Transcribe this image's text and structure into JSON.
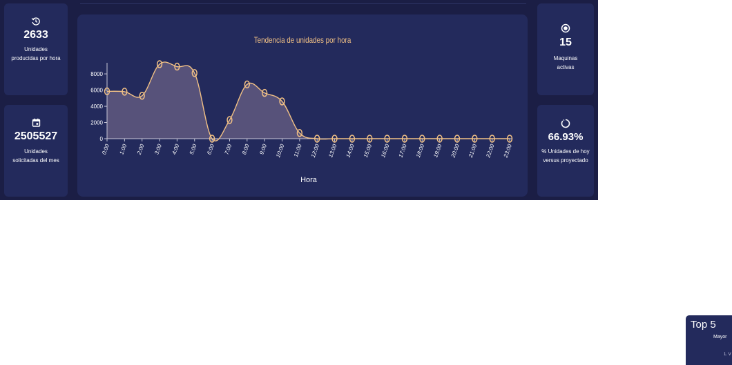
{
  "kpis": {
    "produced": {
      "value": "2633",
      "label": "Unidades producidas por hora",
      "icon": "clock-reset-icon"
    },
    "requested": {
      "value": "2505527",
      "label": "Unidades solicitadas del mes",
      "icon": "calendar-icon"
    },
    "machines": {
      "value": "15",
      "label": "Maquinas activas",
      "icon": "radio-dot-icon"
    },
    "percent": {
      "value": "66.93%",
      "label": "% Unidades de hoy versus proyectado",
      "icon": "circle-progress-icon"
    }
  },
  "top5": {
    "title": "Top 5",
    "subtitle": "Mayor",
    "first_item": "1. V"
  },
  "colors": {
    "background": "#1b1e45",
    "card": "#232a5c",
    "line": "#f2c185",
    "area": "#57527a"
  },
  "chart_data": {
    "type": "area",
    "title": "Tendencia de unidades por hora",
    "xlabel": "Hora",
    "ylabel": "",
    "categories": [
      "0:00",
      "1:00",
      "2:00",
      "3:00",
      "4:00",
      "5:00",
      "6:00",
      "7:00",
      "8:00",
      "9:00",
      "10:00",
      "11:00",
      "12:00",
      "13:00",
      "14:00",
      "15:00",
      "16:00",
      "17:00",
      "18:00",
      "19:00",
      "20:00",
      "21:00",
      "22:00",
      "23:00"
    ],
    "values": [
      5850,
      5800,
      5300,
      9200,
      8900,
      8100,
      0,
      2300,
      6700,
      5650,
      4600,
      700,
      0,
      0,
      0,
      0,
      0,
      0,
      0,
      0,
      0,
      0,
      0,
      0
    ],
    "yticks": [
      0,
      2000,
      4000,
      6000,
      8000
    ],
    "ylim": [
      0,
      9200
    ],
    "grid": false,
    "legend": "none"
  }
}
